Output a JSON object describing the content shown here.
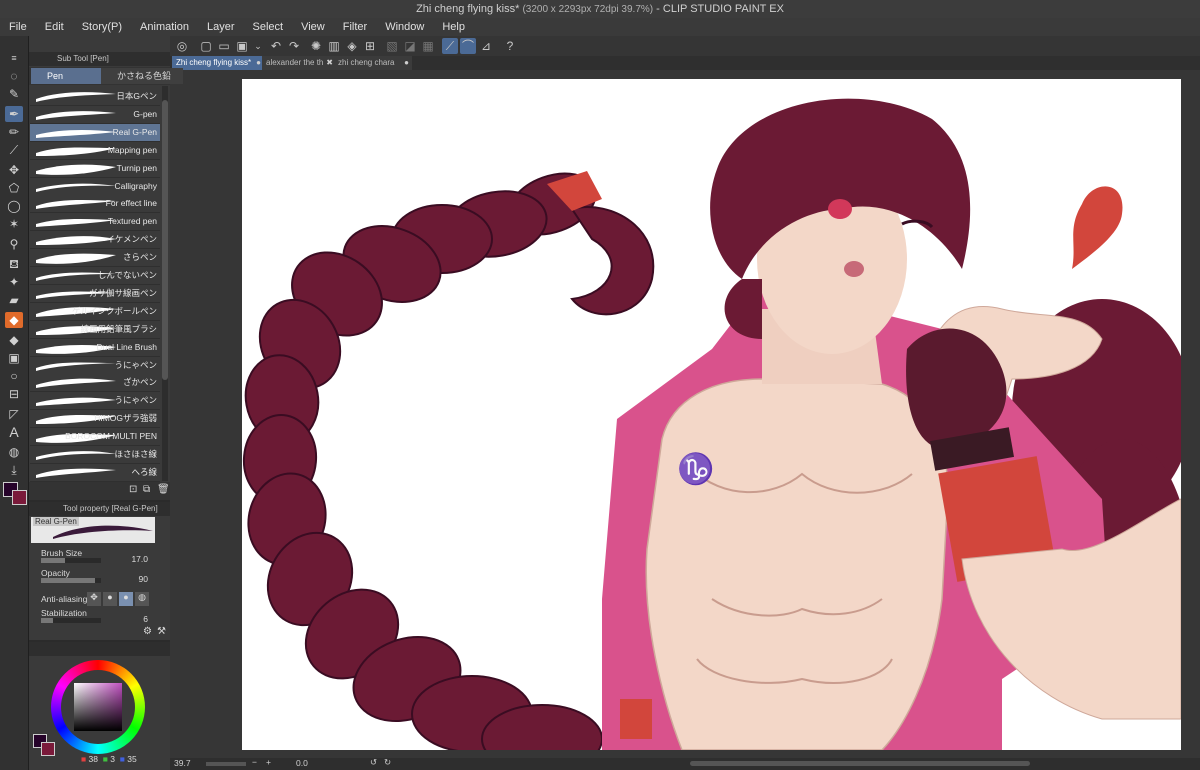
{
  "window": {
    "title_doc": "Zhi cheng flying kiss*",
    "title_info": "(3200 x 2293px 72dpi 39.7%)",
    "title_app": "- CLIP STUDIO PAINT EX"
  },
  "menu": [
    "File",
    "Edit",
    "Story(P)",
    "Animation",
    "Layer",
    "Select",
    "View",
    "Filter",
    "Window",
    "Help"
  ],
  "tabs": [
    {
      "label": "Zhi cheng flying kiss*",
      "close": "●"
    },
    {
      "label": "alexander the th",
      "close": "✖"
    },
    {
      "label": "zhi cheng chara",
      "close": "●"
    }
  ],
  "subtool_panel": {
    "header": "Sub Tool [Pen]",
    "groups": [
      "Pen",
      "かさねる色鉛"
    ],
    "brushes": [
      "日本Gペン",
      "G-pen",
      "Real G-Pen",
      "Mapping pen",
      "Turnip pen",
      "Calligraphy",
      "For effect line",
      "Textured pen",
      "イケメンペン",
      "さらペン",
      "しんでないペン",
      "ガサ伽サ線画ペン",
      "ゲルインクボールペン",
      "線画用鉛筆風ブラシ",
      "Dual Line Brush",
      "うにゃペン",
      "ざかペン",
      "うにゃペン",
      "HIMOGザラ強弱",
      "BOROCOM MULTI PEN",
      "ほさほさ線",
      "へろ線"
    ],
    "selected_index": 2
  },
  "tool_property": {
    "header": "Tool property [Real G-Pen]",
    "preview_label": "Real G-Pen",
    "brush_size_label": "Brush Size",
    "brush_size_value": "17.0",
    "opacity_label": "Opacity",
    "opacity_value": "90",
    "anti_aliasing_label": "Anti-aliasing",
    "stabilization_label": "Stabilization",
    "stabilization_value": "6"
  },
  "color_panel": {
    "r": "38",
    "g": "3",
    "b": "35",
    "main_color": "#26032a",
    "sub_color": "#7a1a3a"
  },
  "status": {
    "zoom": "39.7",
    "rotation": "0.0"
  },
  "colors": {
    "accent": "#4b6a96",
    "hair": "#6b1a34",
    "jacket": "#d9528c",
    "skin": "#f3d7c8"
  }
}
